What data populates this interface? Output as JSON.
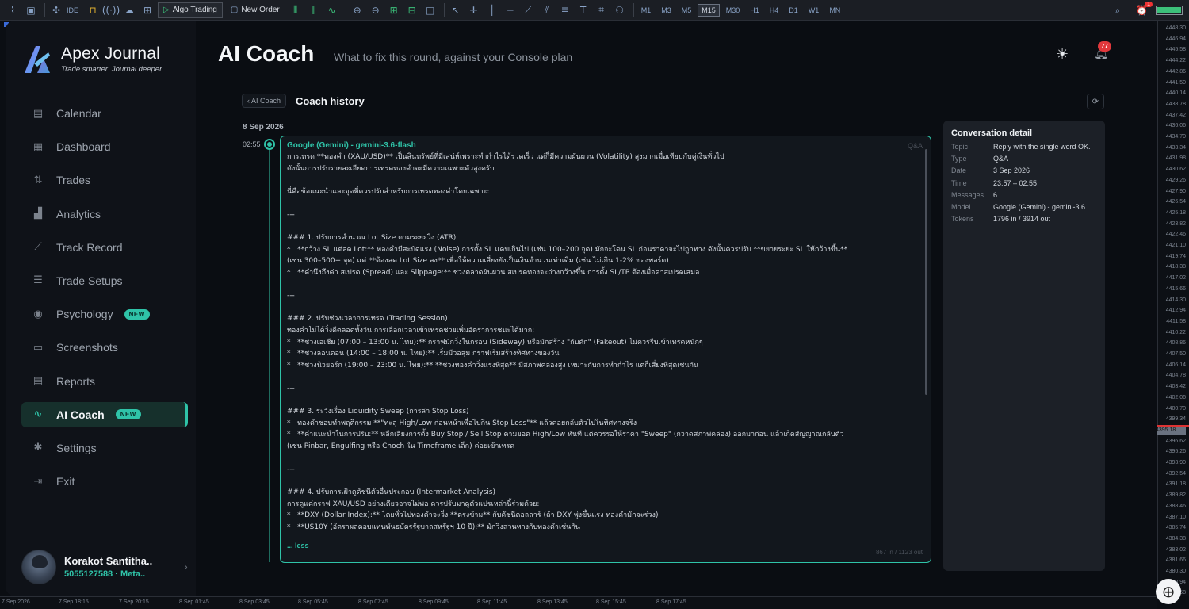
{
  "toolbar": {
    "algo_trading": "Algo Trading",
    "new_order": "New Order",
    "ide": "IDE",
    "timeframes": [
      "M1",
      "M3",
      "M5",
      "M15",
      "M30",
      "H1",
      "H4",
      "D1",
      "W1",
      "MN"
    ],
    "active_timeframe": "M15",
    "alarm_count": "1"
  },
  "price_axis": [
    "4448.30",
    "4446.94",
    "4445.58",
    "4444.22",
    "4442.86",
    "4441.50",
    "4440.14",
    "4438.78",
    "4437.42",
    "4436.06",
    "4434.70",
    "4433.34",
    "4431.98",
    "4430.62",
    "4429.26",
    "4427.90",
    "4426.54",
    "4425.18",
    "4423.82",
    "4422.46",
    "4421.10",
    "4419.74",
    "4418.38",
    "4417.02",
    "4415.66",
    "4414.30",
    "4412.94",
    "4411.58",
    "4410.22",
    "4408.86",
    "4407.50",
    "4406.14",
    "4404.78",
    "4403.42",
    "4402.06",
    "4400.70",
    "4399.34",
    "4397.98",
    "4396.62",
    "4395.26",
    "4393.90",
    "4392.54",
    "4391.18",
    "4389.82",
    "4388.46",
    "4387.10",
    "4385.74",
    "4384.38",
    "4383.02",
    "4381.66",
    "4380.30",
    "4378.94",
    "4377.58"
  ],
  "price_current": "4395.18",
  "time_axis": [
    "7 Sep 2026",
    "7 Sep 18:15",
    "7 Sep 20:15",
    "8 Sep 01:45",
    "8 Sep 03:45",
    "8 Sep 05:45",
    "8 Sep 07:45",
    "8 Sep 09:45",
    "8 Sep 11:45",
    "8 Sep 13:45",
    "8 Sep 15:45",
    "8 Sep 17:45"
  ],
  "brand": {
    "name": "Apex Journal",
    "tagline": "Trade smarter. Journal deeper."
  },
  "nav": [
    {
      "label": "Calendar",
      "icon": "calendar-icon",
      "glyph": "▤"
    },
    {
      "label": "Dashboard",
      "icon": "grid-icon",
      "glyph": "▦"
    },
    {
      "label": "Trades",
      "icon": "trades-icon",
      "glyph": "⇅"
    },
    {
      "label": "Analytics",
      "icon": "bar-chart-icon",
      "glyph": "▟"
    },
    {
      "label": "Track Record",
      "icon": "trend-icon",
      "glyph": "⟋"
    },
    {
      "label": "Trade Setups",
      "icon": "sliders-icon",
      "glyph": "☰"
    },
    {
      "label": "Psychology",
      "icon": "brain-icon",
      "glyph": "◉",
      "badge": "NEW"
    },
    {
      "label": "Screenshots",
      "icon": "image-icon",
      "glyph": "▭"
    },
    {
      "label": "Reports",
      "icon": "report-icon",
      "glyph": "▤"
    },
    {
      "label": "AI Coach",
      "icon": "pulse-icon",
      "glyph": "∿",
      "badge": "NEW",
      "active": true
    },
    {
      "label": "Settings",
      "icon": "gear-icon",
      "glyph": "✱"
    },
    {
      "label": "Exit",
      "icon": "exit-icon",
      "glyph": "⇥"
    }
  ],
  "user": {
    "name": "Korakot Santitha..",
    "account": "5055127588 · Meta.."
  },
  "header": {
    "title": "AI Coach",
    "subtitle": "What to fix this round, against your Console plan",
    "notification_count": "77"
  },
  "history": {
    "back_label": "‹ AI Coach",
    "title": "Coach history",
    "date": "8 Sep 2026",
    "time": "02:55"
  },
  "message": {
    "model": "Google (Gemini) - gemini-3.6-flash",
    "type": "Q&A",
    "body": "การเทรด **ทองคำ (XAU/USD)** เป็นสินทรัพย์ที่มีเสน่ห์เพราะทำกำไรได้รวดเร็ว แต่ก็มีความผันผวน (Volatility) สูงมากเมื่อเทียบกับคู่เงินทั่วไป\nดังนั้นการปรับรายละเอียดการเทรดทองคำจะมีความเฉพาะตัวสูงครับ\n\nนี่คือข้อแนะนำและจุดที่ควรปรับสำหรับการเทรดทองคำโดยเฉพาะ:\n\n---\n\n### 1. ปรับการคำนวณ Lot Size ตามระยะวิ่ง (ATR)\n*   **กว้าง SL แต่ลด Lot:** ทองคำมีสะบัดแรง (Noise) การตั้ง SL แคบเกินไป (เช่น 100–200 จุด) มักจะโดน SL ก่อนราคาจะไปถูกทาง ดังนั้นควรปรับ **ขยายระยะ SL ให้กว้างขึ้น**\n(เช่น 300–500+ จุด) แต่ **ต้องลด Lot Size ลง** เพื่อให้ความเสี่ยงยังเป็นเงินจำนวนเท่าเดิม (เช่น ไม่เกิน 1-2% ของพอร์ต)\n*   **คำนึงถึงค่า สเปรด (Spread) และ Slippage:** ช่วงตลาดผันผวน สเปรดทองจะถ่างกว้างขึ้น การตั้ง SL/TP ต้องเผื่อค่าสเปรดเสมอ\n\n---\n\n### 2. ปรับช่วงเวลาการเทรด (Trading Session)\nทองคำไม่ได้วิ่งดีตลอดทั้งวัน การเลือกเวลาเข้าเทรดช่วยเพิ่มอัตราการชนะได้มาก:\n*   **ช่วงเอเชีย (07:00 – 13:00 น. ไทย):** กราฟมักวิ่งในกรอบ (Sideway) หรือมักสร้าง \"กับดัก\" (Fakeout) ไม่ควรรีบเข้าเทรดหนักๆ\n*   **ช่วงลอนดอน (14:00 – 18:00 น. ไทย):** เริ่มมีวอลุ่ม กราฟเริ่มสร้างทิศทางของวัน\n*   **ช่วงนิวยอร์ก (19:00 – 23:00 น. ไทย):** **ช่วงทองคำวิ่งแรงที่สุด** มีสภาพคล่องสูง เหมาะกับการทำกำไร แต่ก็เสี่ยงที่สุดเช่นกัน\n\n---\n\n### 3. ระวังเรื่อง Liquidity Sweep (การล่า Stop Loss)\n*   ทองคำชอบทำพฤติกรรม **\"ทะลุ High/Low ก่อนหน้าเพื่อไปกิน Stop Loss\"** แล้วค่อยกลับตัวไปในทิศทางจริง\n*   **คำแนะนำในการปรับ:** หลีกเลี่ยงการตั้ง Buy Stop / Sell Stop ตามยอด High/Low ทันที แต่ควรรอให้ราคา \"Sweep\" (กวาดสภาพคล่อง) ออกมาก่อน แล้วเกิดสัญญาณกลับตัว\n(เช่น Pinbar, Engulfing หรือ Choch ใน Timeframe เล็ก) ค่อยเข้าเทรด\n\n---\n\n### 4. ปรับการเฝ้าดูดัชนีตัวอื่นประกอบ (Intermarket Analysis)\nการดูแค่กราฟ XAU/USD อย่างเดียวอาจไม่พอ ควรปรับมาดูตัวแปรเหล่านี้ร่วมด้วย:\n*   **DXY (Dollar Index):** โดยทั่วไปทองคำจะวิ่ง **ตรงข้าม** กับดัชนีดอลลาร์ (ถ้า DXY พุ่งขึ้นแรง ทองคำมักจะร่วง)\n*   **US10Y (อัตราผลตอบแทนพันธบัตรรัฐบาลสหรัฐฯ 10 ปี):** มักวิ่งสวนทางกับทองคำเช่นกัน",
    "less_label": "... less",
    "tokens": "867 in / 1123 out"
  },
  "detail": {
    "title": "Conversation detail",
    "rows": [
      {
        "k": "Topic",
        "v": "Reply with the single word OK."
      },
      {
        "k": "Type",
        "v": "Q&A"
      },
      {
        "k": "Date",
        "v": "3 Sep 2026"
      },
      {
        "k": "Time",
        "v": "23:57 – 02:55"
      },
      {
        "k": "Messages",
        "v": "6"
      },
      {
        "k": "Model",
        "v": "Google (Gemini) - gemini-3.6.."
      },
      {
        "k": "Tokens",
        "v": "1796 in / 3914 out"
      }
    ]
  },
  "colors": {
    "accent": "#2fc3a8",
    "background": "#0a0d12",
    "sidebar": "#0f1218",
    "badge_red": "#e0383c"
  }
}
